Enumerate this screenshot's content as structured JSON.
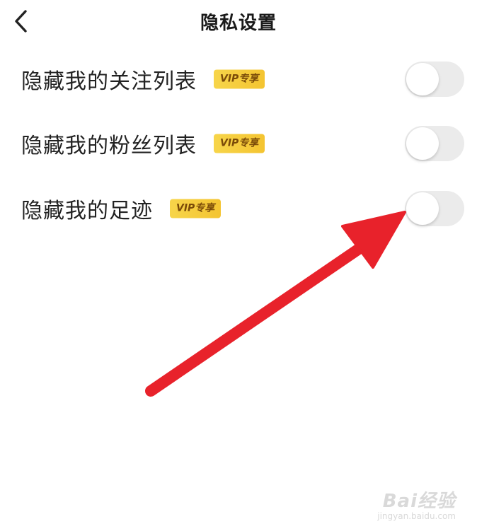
{
  "header": {
    "title": "隐私设置",
    "back_icon": "chevron-left-icon"
  },
  "settings": [
    {
      "label": "隐藏我的关注列表",
      "badge": "VIP专享",
      "toggle_on": false
    },
    {
      "label": "隐藏我的粉丝列表",
      "badge": "VIP专享",
      "toggle_on": false
    },
    {
      "label": "隐藏我的足迹",
      "badge": "VIP专享",
      "toggle_on": false
    }
  ],
  "annotation": {
    "icon": "red-arrow-icon",
    "color": "#e8222b"
  },
  "colors": {
    "badge_gold": "#f4c431",
    "toggle_off": "#ebebeb"
  },
  "watermark": {
    "main": "Bai经验",
    "sub": "jingyan.baidu.com"
  }
}
